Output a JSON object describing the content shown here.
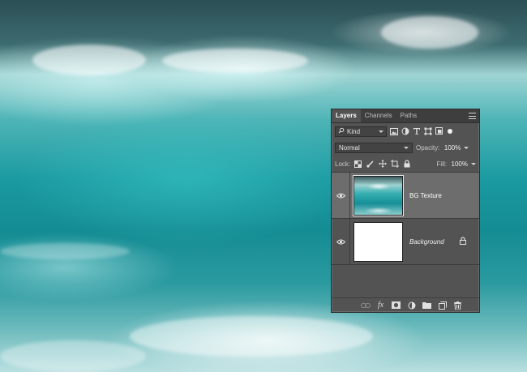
{
  "panel": {
    "tabs": [
      {
        "label": "Layers",
        "active": true
      },
      {
        "label": "Channels",
        "active": false
      },
      {
        "label": "Paths",
        "active": false
      }
    ],
    "filter": {
      "kind_label": "Kind",
      "icons": [
        "image-filter-icon",
        "adjustment-filter-icon",
        "type-filter-icon",
        "shape-filter-icon",
        "smart-object-filter-icon"
      ]
    },
    "blend_mode": "Normal",
    "opacity_label": "Opacity:",
    "opacity_value": "100%",
    "lock_label": "Lock:",
    "fill_label": "Fill:",
    "fill_value": "100%",
    "layers": [
      {
        "name": "BG Texture",
        "visible": true,
        "selected": true,
        "locked": false
      },
      {
        "name": "Background",
        "visible": true,
        "selected": false,
        "locked": true
      }
    ],
    "bottom_icons": [
      "link-layers-icon",
      "fx-icon",
      "add-mask-icon",
      "adjustment-layer-icon",
      "new-group-icon",
      "new-layer-icon",
      "delete-layer-icon"
    ],
    "fx_label": "fx"
  },
  "colors": {
    "panel_bg": "#535353",
    "selected_layer_bg": "#6d6d6d",
    "tabbar_bg": "#3e3e3e"
  }
}
